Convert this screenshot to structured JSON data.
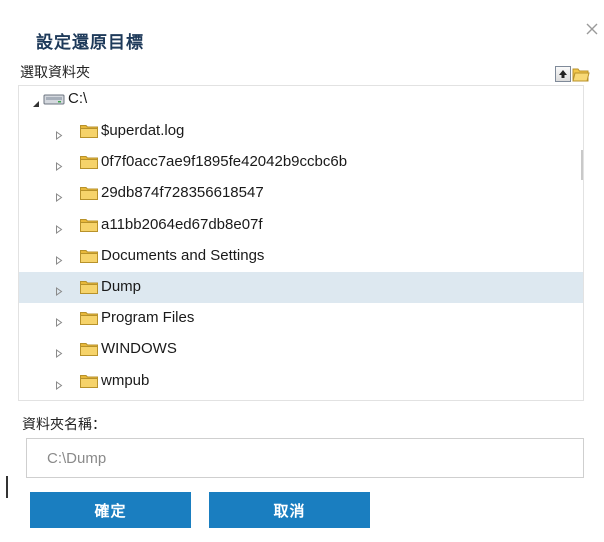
{
  "dialog": {
    "title": "設定還原目標",
    "section_label": "選取資料夾",
    "toolbar": {
      "up_icon": "up-arrow-icon",
      "new_folder_icon": "new-folder-icon"
    },
    "tree": {
      "root": {
        "label": "C:\\",
        "icon": "drive-icon",
        "expanded": true
      },
      "items": [
        {
          "label": "$uperdat.log",
          "icon": "folder-icon",
          "selected": false
        },
        {
          "label": "0f7f0acc7ae9f1895fe42042b9ccbc6b",
          "icon": "folder-icon",
          "selected": false
        },
        {
          "label": "29db874f728356618547",
          "icon": "folder-icon",
          "selected": false
        },
        {
          "label": "a11bb2064ed67db8e07f",
          "icon": "folder-icon",
          "selected": false
        },
        {
          "label": "Documents and Settings",
          "icon": "folder-icon",
          "selected": false
        },
        {
          "label": "Dump",
          "icon": "folder-icon",
          "selected": true
        },
        {
          "label": "Program Files",
          "icon": "folder-icon",
          "selected": false
        },
        {
          "label": "WINDOWS",
          "icon": "folder-icon",
          "selected": false
        },
        {
          "label": "wmpub",
          "icon": "folder-icon",
          "selected": false
        }
      ]
    },
    "folder_name_label": "資料夾名稱：",
    "folder_name_value": "C:\\Dump",
    "buttons": {
      "ok": "確定",
      "cancel": "取消"
    },
    "colors": {
      "accent": "#1a7ec0",
      "title": "#1e3a5a",
      "selected_row": "#dde8f0",
      "folder": "#f3c74a"
    }
  }
}
